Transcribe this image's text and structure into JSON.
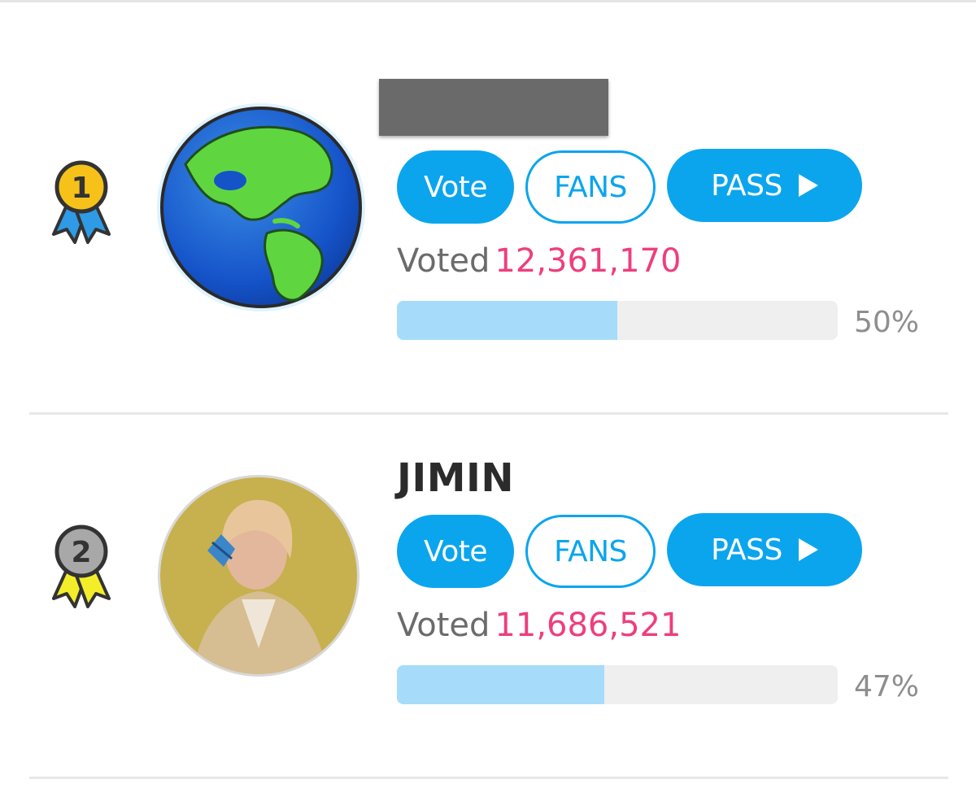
{
  "ranking": [
    {
      "rank": "1",
      "name": "",
      "name_redacted": true,
      "avatar": "globe-image",
      "medal_color": "#f6c21a",
      "ribbon_color": "#2f9ae6",
      "vote_label": "Vote",
      "fans_label": "FANS",
      "pass_label": "PASS",
      "voted_label": "Voted",
      "votes": "12,361,170",
      "percent": "50%",
      "progress": 0.5
    },
    {
      "rank": "2",
      "name": "JIMIN",
      "name_redacted": false,
      "avatar": "artist-photo",
      "medal_color": "#a8a8a8",
      "ribbon_color": "#f4ee2a",
      "vote_label": "Vote",
      "fans_label": "FANS",
      "pass_label": "PASS",
      "voted_label": "Voted",
      "votes": "11,686,521",
      "percent": "47%",
      "progress": 0.47
    }
  ],
  "colors": {
    "accent": "#0ba5ee",
    "vote_count": "#ee3e7e",
    "progress_fill": "#a6dcf9",
    "progress_track": "#efefef"
  },
  "icons": [
    "medal-icon",
    "play-icon"
  ]
}
